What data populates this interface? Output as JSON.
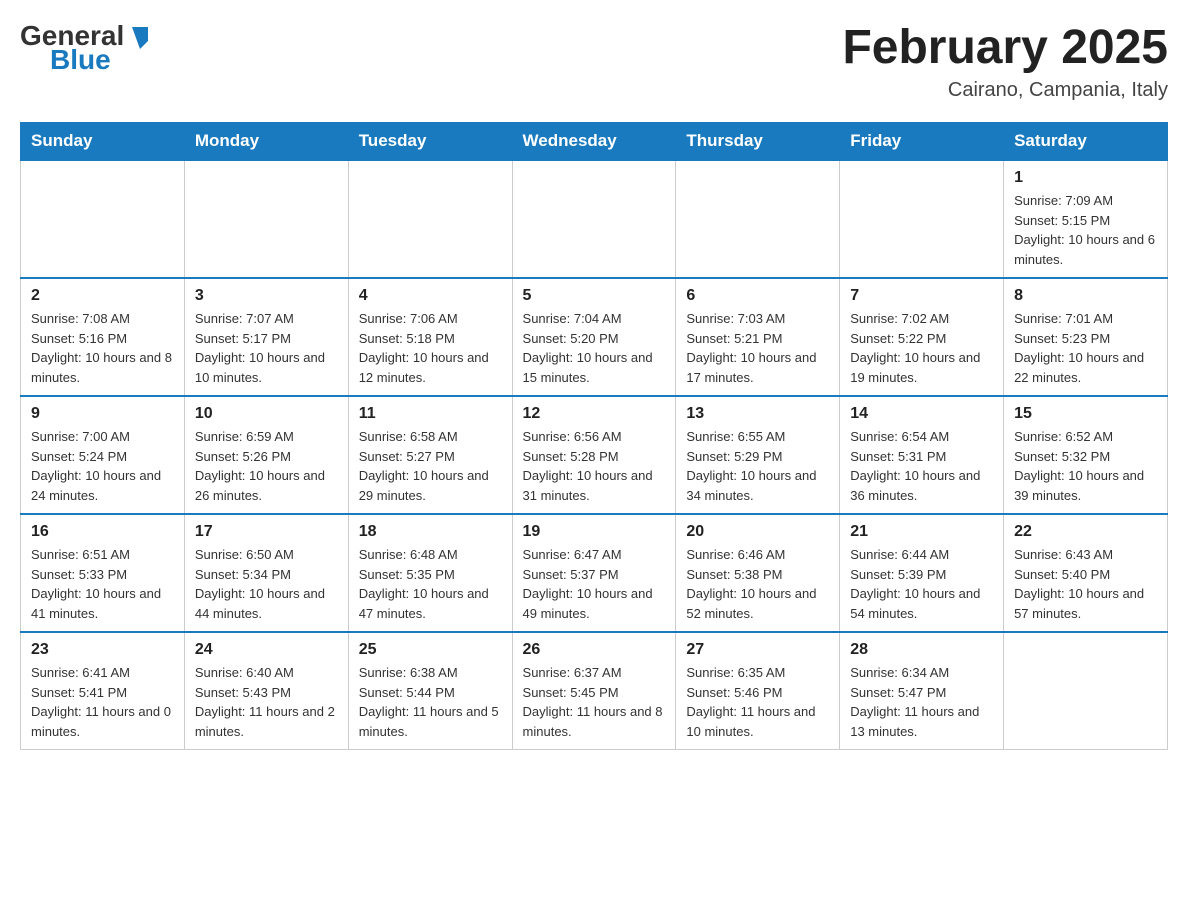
{
  "logo": {
    "general": "General",
    "blue": "Blue"
  },
  "header": {
    "title": "February 2025",
    "location": "Cairano, Campania, Italy"
  },
  "days_of_week": [
    "Sunday",
    "Monday",
    "Tuesday",
    "Wednesday",
    "Thursday",
    "Friday",
    "Saturday"
  ],
  "weeks": [
    [
      {
        "day": "",
        "info": ""
      },
      {
        "day": "",
        "info": ""
      },
      {
        "day": "",
        "info": ""
      },
      {
        "day": "",
        "info": ""
      },
      {
        "day": "",
        "info": ""
      },
      {
        "day": "",
        "info": ""
      },
      {
        "day": "1",
        "info": "Sunrise: 7:09 AM\nSunset: 5:15 PM\nDaylight: 10 hours and 6 minutes."
      }
    ],
    [
      {
        "day": "2",
        "info": "Sunrise: 7:08 AM\nSunset: 5:16 PM\nDaylight: 10 hours and 8 minutes."
      },
      {
        "day": "3",
        "info": "Sunrise: 7:07 AM\nSunset: 5:17 PM\nDaylight: 10 hours and 10 minutes."
      },
      {
        "day": "4",
        "info": "Sunrise: 7:06 AM\nSunset: 5:18 PM\nDaylight: 10 hours and 12 minutes."
      },
      {
        "day": "5",
        "info": "Sunrise: 7:04 AM\nSunset: 5:20 PM\nDaylight: 10 hours and 15 minutes."
      },
      {
        "day": "6",
        "info": "Sunrise: 7:03 AM\nSunset: 5:21 PM\nDaylight: 10 hours and 17 minutes."
      },
      {
        "day": "7",
        "info": "Sunrise: 7:02 AM\nSunset: 5:22 PM\nDaylight: 10 hours and 19 minutes."
      },
      {
        "day": "8",
        "info": "Sunrise: 7:01 AM\nSunset: 5:23 PM\nDaylight: 10 hours and 22 minutes."
      }
    ],
    [
      {
        "day": "9",
        "info": "Sunrise: 7:00 AM\nSunset: 5:24 PM\nDaylight: 10 hours and 24 minutes."
      },
      {
        "day": "10",
        "info": "Sunrise: 6:59 AM\nSunset: 5:26 PM\nDaylight: 10 hours and 26 minutes."
      },
      {
        "day": "11",
        "info": "Sunrise: 6:58 AM\nSunset: 5:27 PM\nDaylight: 10 hours and 29 minutes."
      },
      {
        "day": "12",
        "info": "Sunrise: 6:56 AM\nSunset: 5:28 PM\nDaylight: 10 hours and 31 minutes."
      },
      {
        "day": "13",
        "info": "Sunrise: 6:55 AM\nSunset: 5:29 PM\nDaylight: 10 hours and 34 minutes."
      },
      {
        "day": "14",
        "info": "Sunrise: 6:54 AM\nSunset: 5:31 PM\nDaylight: 10 hours and 36 minutes."
      },
      {
        "day": "15",
        "info": "Sunrise: 6:52 AM\nSunset: 5:32 PM\nDaylight: 10 hours and 39 minutes."
      }
    ],
    [
      {
        "day": "16",
        "info": "Sunrise: 6:51 AM\nSunset: 5:33 PM\nDaylight: 10 hours and 41 minutes."
      },
      {
        "day": "17",
        "info": "Sunrise: 6:50 AM\nSunset: 5:34 PM\nDaylight: 10 hours and 44 minutes."
      },
      {
        "day": "18",
        "info": "Sunrise: 6:48 AM\nSunset: 5:35 PM\nDaylight: 10 hours and 47 minutes."
      },
      {
        "day": "19",
        "info": "Sunrise: 6:47 AM\nSunset: 5:37 PM\nDaylight: 10 hours and 49 minutes."
      },
      {
        "day": "20",
        "info": "Sunrise: 6:46 AM\nSunset: 5:38 PM\nDaylight: 10 hours and 52 minutes."
      },
      {
        "day": "21",
        "info": "Sunrise: 6:44 AM\nSunset: 5:39 PM\nDaylight: 10 hours and 54 minutes."
      },
      {
        "day": "22",
        "info": "Sunrise: 6:43 AM\nSunset: 5:40 PM\nDaylight: 10 hours and 57 minutes."
      }
    ],
    [
      {
        "day": "23",
        "info": "Sunrise: 6:41 AM\nSunset: 5:41 PM\nDaylight: 11 hours and 0 minutes."
      },
      {
        "day": "24",
        "info": "Sunrise: 6:40 AM\nSunset: 5:43 PM\nDaylight: 11 hours and 2 minutes."
      },
      {
        "day": "25",
        "info": "Sunrise: 6:38 AM\nSunset: 5:44 PM\nDaylight: 11 hours and 5 minutes."
      },
      {
        "day": "26",
        "info": "Sunrise: 6:37 AM\nSunset: 5:45 PM\nDaylight: 11 hours and 8 minutes."
      },
      {
        "day": "27",
        "info": "Sunrise: 6:35 AM\nSunset: 5:46 PM\nDaylight: 11 hours and 10 minutes."
      },
      {
        "day": "28",
        "info": "Sunrise: 6:34 AM\nSunset: 5:47 PM\nDaylight: 11 hours and 13 minutes."
      },
      {
        "day": "",
        "info": ""
      }
    ]
  ]
}
